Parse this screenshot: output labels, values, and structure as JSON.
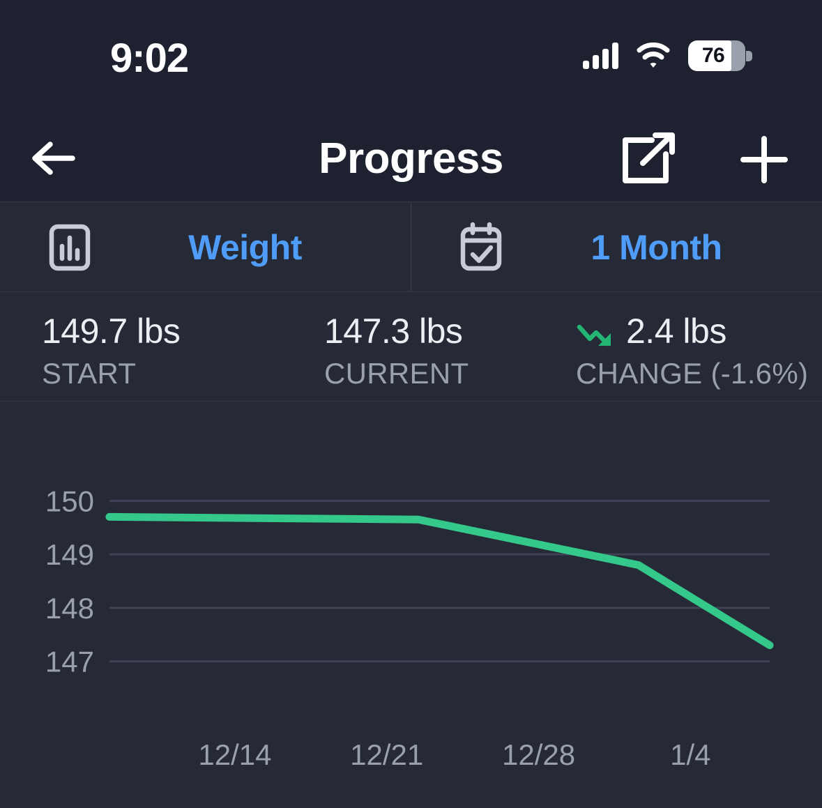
{
  "status_bar": {
    "time": "9:02",
    "battery_percent": "76",
    "battery_level": 76,
    "icons": [
      "cellular-signal-icon",
      "wifi-icon",
      "battery-icon"
    ]
  },
  "nav_bar": {
    "title": "Progress",
    "back_icon": "back-arrow-icon",
    "share_icon": "share-external-link-icon",
    "add_icon": "plus-icon"
  },
  "selectors": [
    {
      "icon": "bar-chart-icon",
      "label": "Weight"
    },
    {
      "icon": "calendar-check-icon",
      "label": "1 Month"
    }
  ],
  "stats": [
    {
      "value": "149.7 lbs",
      "label": "START",
      "trend_icon": null
    },
    {
      "value": "147.3 lbs",
      "label": "CURRENT",
      "trend_icon": null
    },
    {
      "value": "2.4 lbs",
      "label": "CHANGE (-1.6%)",
      "trend_icon": "trend-down-icon"
    }
  ],
  "colors": {
    "accent_blue": "#4f9cf9",
    "line_green": "#34c88a",
    "status_bar_bg": "#1e2130",
    "body_bg": "#262a36",
    "grid": "#3d4254",
    "muted_text": "#9aa0ae"
  },
  "chart_data": {
    "type": "line",
    "title": "",
    "xlabel": "",
    "ylabel": "",
    "unit": "lbs",
    "grid": true,
    "legend": "none",
    "ylim": [
      146.5,
      150.2
    ],
    "yticks": [
      150,
      149,
      148,
      147
    ],
    "ytick_labels": [
      "150",
      "149",
      "148",
      "147"
    ],
    "xtick_labels": [
      "12/14",
      "12/21",
      "12/28",
      "1/4"
    ],
    "xtick_positions": [
      0.19,
      0.42,
      0.65,
      0.88
    ],
    "series": [
      {
        "name": "Weight",
        "color": "#34c88a",
        "x": [
          "12/9",
          "12/21",
          "12/30",
          "1/6"
        ],
        "values": [
          149.7,
          149.65,
          148.8,
          147.3
        ],
        "x_frac": [
          0.0,
          0.468,
          0.801,
          1.0
        ]
      }
    ]
  }
}
